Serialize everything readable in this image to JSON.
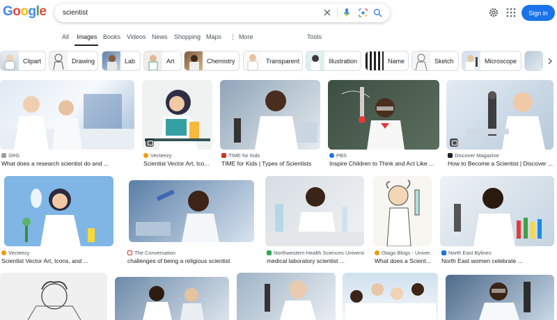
{
  "header": {
    "logo": [
      "G",
      "o",
      "o",
      "g",
      "l",
      "e"
    ],
    "search_value": "scientist",
    "signin_label": "Sign in"
  },
  "tabs": [
    {
      "label": "All"
    },
    {
      "label": "Images",
      "active": true
    },
    {
      "label": "Books"
    },
    {
      "label": "Videos"
    },
    {
      "label": "News"
    },
    {
      "label": "Shopping"
    },
    {
      "label": "Maps"
    },
    {
      "label": "More"
    },
    {
      "label": "Tools"
    }
  ],
  "chips": [
    {
      "label": "Clipart"
    },
    {
      "label": "Drawing"
    },
    {
      "label": "Lab"
    },
    {
      "label": "Art"
    },
    {
      "label": "Chemistry"
    },
    {
      "label": "Transparent"
    },
    {
      "label": "Illustration"
    },
    {
      "label": "Name"
    },
    {
      "label": "Sketch"
    },
    {
      "label": "Microscope"
    }
  ],
  "results": [
    {
      "source": "SRG",
      "title": "What does a research scientist do and ..."
    },
    {
      "source": "Vecteezy",
      "title": "Scientist Vector Art, Ico..."
    },
    {
      "source": "TIME for Kids",
      "title": "TIME for Kids | Types of Scientists"
    },
    {
      "source": "PBS",
      "title": "Inspire Children to Think and Act Like ..."
    },
    {
      "source": "Discover Magazine",
      "title": "How to Become a Scientist | Discover ..."
    },
    {
      "source": "Vecteezy",
      "title": "Scientist Vector Art, Icons, and ..."
    },
    {
      "source": "The Conversation",
      "title": "challenges of being a religious scientist"
    },
    {
      "source": "Northwestern Health Sciences University",
      "title": "medical laboratory scientist ..."
    },
    {
      "source": "Otago Blogs - Univer...",
      "title": "What does a Scient..."
    },
    {
      "source": "North East Bylines",
      "title": "North East women celebrate ..."
    }
  ],
  "colors": {
    "accent": "#1a73e8",
    "text": "#202124",
    "muted": "#4d5156"
  }
}
